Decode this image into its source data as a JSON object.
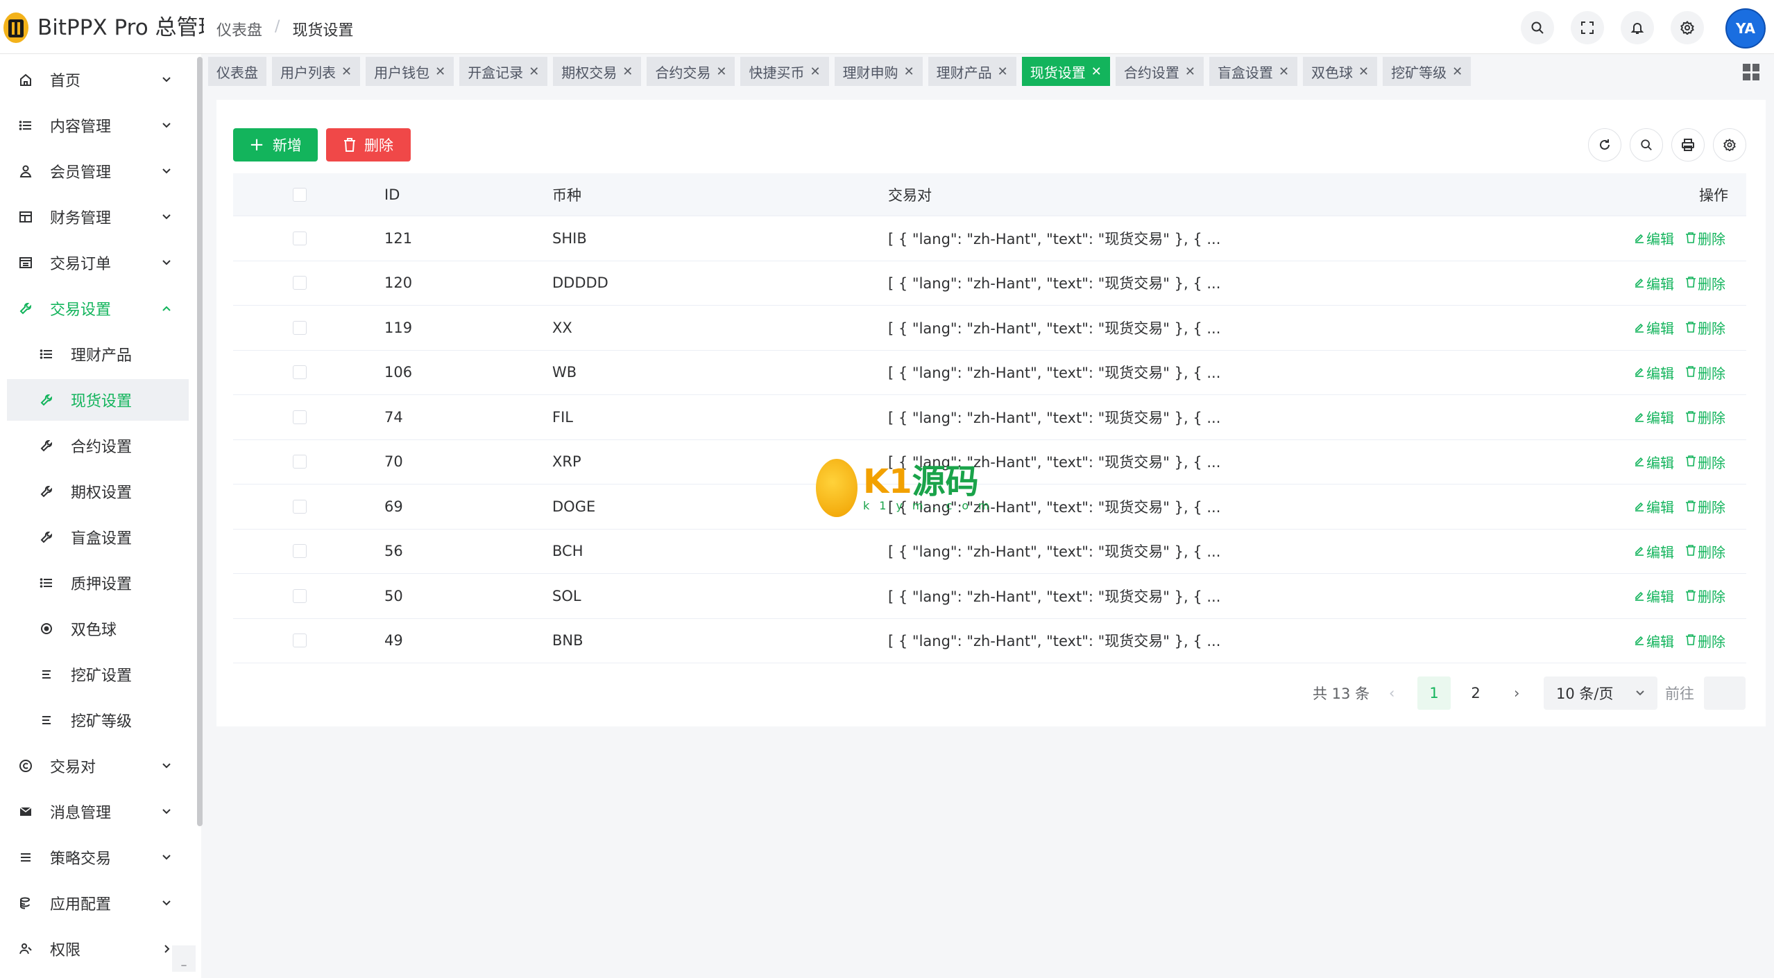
{
  "app": {
    "title": "BitPPX Pro 总管理后台"
  },
  "breadcrumb": {
    "home": "仪表盘",
    "separator": "/",
    "current": "现货设置"
  },
  "header": {
    "icons": [
      "search-icon",
      "fullscreen-icon",
      "bell-icon",
      "gear-icon"
    ],
    "avatar_text": "YA"
  },
  "sidebar": {
    "items": [
      {
        "label": "首页",
        "icon": "home-icon"
      },
      {
        "label": "内容管理",
        "icon": "list-icon"
      },
      {
        "label": "会员管理",
        "icon": "user-icon"
      },
      {
        "label": "财务管理",
        "icon": "table-icon"
      },
      {
        "label": "交易订单",
        "icon": "orders-icon"
      },
      {
        "label": "交易设置",
        "icon": "wrench-icon"
      },
      {
        "label": "理财产品",
        "icon": "list-icon"
      },
      {
        "label": "现货设置",
        "icon": "wrench-icon"
      },
      {
        "label": "合约设置",
        "icon": "wrench-icon"
      },
      {
        "label": "期权设置",
        "icon": "wrench-icon"
      },
      {
        "label": "盲盒设置",
        "icon": "wrench-icon"
      },
      {
        "label": "质押设置",
        "icon": "list-icon"
      },
      {
        "label": "双色球",
        "icon": "target-icon"
      },
      {
        "label": "挖矿设置",
        "icon": "lines-icon"
      },
      {
        "label": "挖矿等级",
        "icon": "lines-icon"
      },
      {
        "label": "交易对",
        "icon": "copyright-icon"
      },
      {
        "label": "消息管理",
        "icon": "message-icon"
      },
      {
        "label": "策略交易",
        "icon": "menu-icon"
      },
      {
        "label": "应用配置",
        "icon": "coins-icon"
      },
      {
        "label": "权限",
        "icon": "users-icon"
      }
    ],
    "bottom_button": "_"
  },
  "tabs": [
    "仪表盘",
    "用户列表",
    "用户钱包",
    "开盒记录",
    "期权交易",
    "合约交易",
    "快捷买币",
    "理财申购",
    "理财产品",
    "现货设置",
    "合约设置",
    "盲盒设置",
    "双色球",
    "挖矿等级"
  ],
  "toolbar": {
    "add_label": "新增",
    "delete_label": "删除",
    "tools": [
      "refresh-icon",
      "search-icon",
      "print-icon",
      "gear-icon"
    ]
  },
  "table": {
    "columns": {
      "id": "ID",
      "coin": "币种",
      "pair": "交易对",
      "ops": "操作"
    },
    "edit_label": "编辑",
    "delete_label": "删除",
    "rows": [
      {
        "id": "121",
        "coin": "SHIB",
        "pair": "[ { \"lang\": \"zh-Hant\", \"text\": \"现货交易\" }, { ..."
      },
      {
        "id": "120",
        "coin": "DDDDD",
        "pair": "[ { \"lang\": \"zh-Hant\", \"text\": \"现货交易\" }, { ..."
      },
      {
        "id": "119",
        "coin": "XX",
        "pair": "[ { \"lang\": \"zh-Hant\", \"text\": \"现货交易\" }, { ..."
      },
      {
        "id": "106",
        "coin": "WB",
        "pair": "[ { \"lang\": \"zh-Hant\", \"text\": \"现货交易\" }, { ..."
      },
      {
        "id": "74",
        "coin": "FIL",
        "pair": "[ { \"lang\": \"zh-Hant\", \"text\": \"现货交易\" }, { ..."
      },
      {
        "id": "70",
        "coin": "XRP",
        "pair": "[ { \"lang\": \"zh-Hant\", \"text\": \"现货交易\" }, { ..."
      },
      {
        "id": "69",
        "coin": "DOGE",
        "pair": "[ { \"lang\": \"zh-Hant\", \"text\": \"现货交易\" }, { ..."
      },
      {
        "id": "56",
        "coin": "BCH",
        "pair": "[ { \"lang\": \"zh-Hant\", \"text\": \"现货交易\" }, { ..."
      },
      {
        "id": "50",
        "coin": "SOL",
        "pair": "[ { \"lang\": \"zh-Hant\", \"text\": \"现货交易\" }, { ..."
      },
      {
        "id": "49",
        "coin": "BNB",
        "pair": "[ { \"lang\": \"zh-Hant\", \"text\": \"现货交易\" }, { ..."
      }
    ]
  },
  "pagination": {
    "total": "共 13 条",
    "pages": [
      "1",
      "2"
    ],
    "current": "1",
    "page_size": "10 条/页",
    "goto_label": "前往"
  },
  "watermark": {
    "main_a": "K1",
    "main_b": "源码",
    "sub": "k1ym.com"
  },
  "colors": {
    "accent": "#13b45c",
    "danger": "#f04848"
  }
}
